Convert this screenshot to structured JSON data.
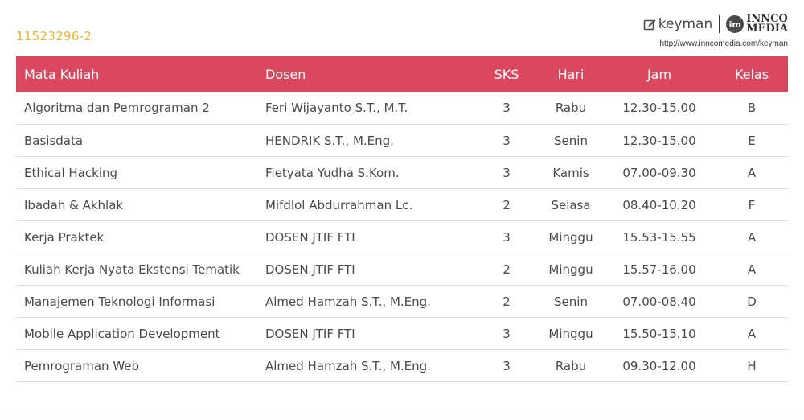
{
  "student_id": "11523296-2",
  "brand": {
    "keyman_label": "keyman",
    "innco_mark": "im",
    "innco_line1": "INNCO",
    "innco_line2": "MEDIA",
    "url": "http://www.inncomedia.com/keyman"
  },
  "colors": {
    "header_bg": "#d9485f",
    "id_color": "#f0b429"
  },
  "table": {
    "headers": [
      "Mata Kuliah",
      "Dosen",
      "SKS",
      "Hari",
      "Jam",
      "Kelas"
    ],
    "rows": [
      [
        "Algoritma dan Pemrograman 2",
        "Feri Wijayanto S.T., M.T.",
        "3",
        "Rabu",
        "12.30-15.00",
        "B"
      ],
      [
        "Basisdata",
        "HENDRIK S.T., M.Eng.",
        "3",
        "Senin",
        "12.30-15.00",
        "E"
      ],
      [
        "Ethical Hacking",
        "Fietyata Yudha S.Kom.",
        "3",
        "Kamis",
        "07.00-09.30",
        "A"
      ],
      [
        "Ibadah & Akhlak",
        "Mifdlol Abdurrahman Lc.",
        "2",
        "Selasa",
        "08.40-10.20",
        "F"
      ],
      [
        "Kerja Praktek",
        "DOSEN JTIF FTI",
        "3",
        "Minggu",
        "15.53-15.55",
        "A"
      ],
      [
        "Kuliah Kerja Nyata Ekstensi Tematik",
        "DOSEN JTIF FTI",
        "2",
        "Minggu",
        "15.57-16.00",
        "A"
      ],
      [
        "Manajemen Teknologi Informasi",
        "Almed Hamzah S.T., M.Eng.",
        "2",
        "Senin",
        "07.00-08.40",
        "D"
      ],
      [
        "Mobile Application Development",
        "DOSEN JTIF FTI",
        "3",
        "Minggu",
        "15.50-15.10",
        "A"
      ],
      [
        "Pemrograman Web",
        "Almed Hamzah S.T., M.Eng.",
        "3",
        "Rabu",
        "09.30-12.00",
        "H"
      ]
    ]
  }
}
